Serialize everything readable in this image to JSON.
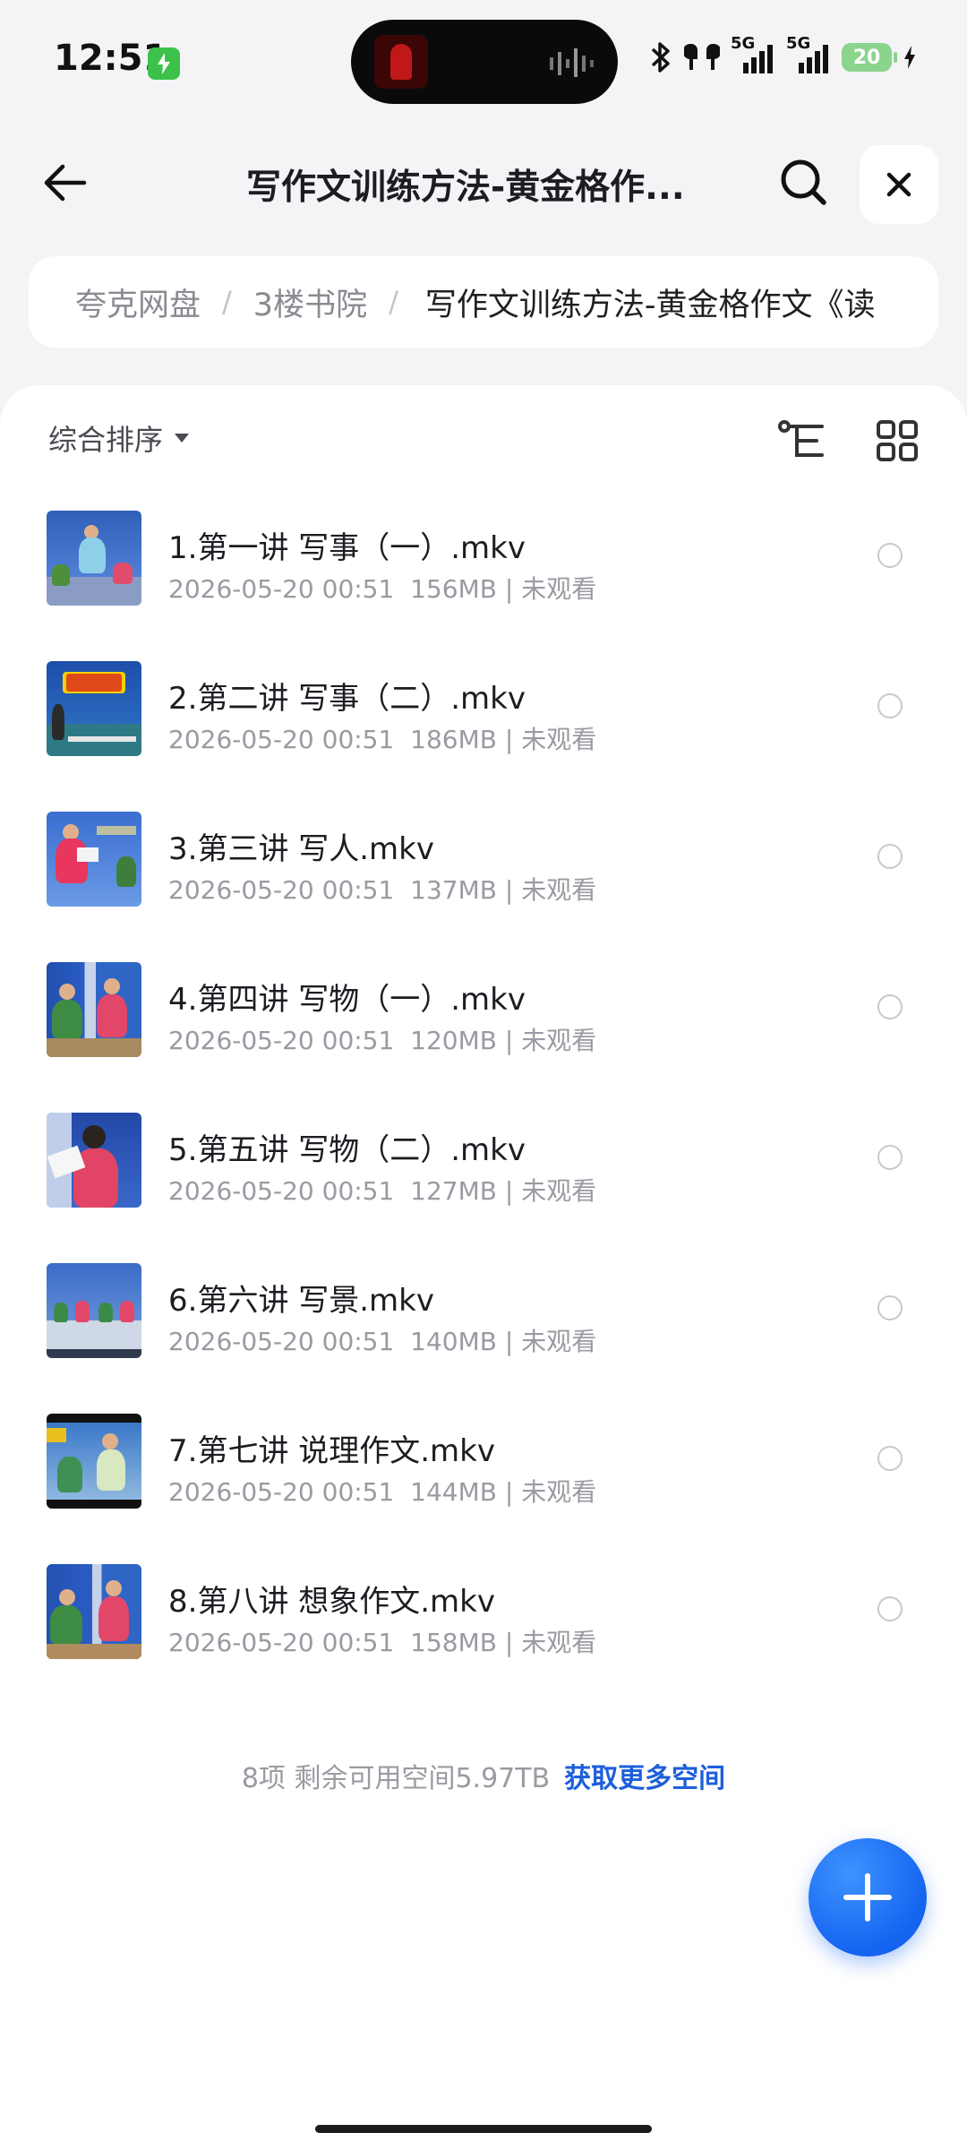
{
  "status_bar": {
    "time": "12:51",
    "network_1": "5G",
    "network_2": "5G",
    "battery": "20"
  },
  "nav": {
    "title": "写作文训练方法-黄金格作..."
  },
  "breadcrumb": {
    "items": [
      "夸克网盘",
      "3楼书院"
    ],
    "separator": "/",
    "current": "写作文训练方法-黄金格作文《读"
  },
  "toolbar": {
    "sort_label": "综合排序"
  },
  "files": [
    {
      "name": "1.第一讲 写事（一）.mkv",
      "date": "2026-05-20 00:51",
      "size": "156MB",
      "status": "未观看"
    },
    {
      "name": "2.第二讲 写事（二）.mkv",
      "date": "2026-05-20 00:51",
      "size": "186MB",
      "status": "未观看"
    },
    {
      "name": "3.第三讲 写人.mkv",
      "date": "2026-05-20 00:51",
      "size": "137MB",
      "status": "未观看"
    },
    {
      "name": "4.第四讲 写物（一）.mkv",
      "date": "2026-05-20 00:51",
      "size": "120MB",
      "status": "未观看"
    },
    {
      "name": "5.第五讲 写物（二）.mkv",
      "date": "2026-05-20 00:51",
      "size": "127MB",
      "status": "未观看"
    },
    {
      "name": "6.第六讲 写景.mkv",
      "date": "2026-05-20 00:51",
      "size": "140MB",
      "status": "未观看"
    },
    {
      "name": "7.第七讲 说理作文.mkv",
      "date": "2026-05-20 00:51",
      "size": "144MB",
      "status": "未观看"
    },
    {
      "name": "8.第八讲 想象作文.mkv",
      "date": "2026-05-20 00:51",
      "size": "158MB",
      "status": "未观看"
    }
  ],
  "footer": {
    "summary": "8项 剩余可用空间5.97TB",
    "link": "获取更多空间"
  },
  "colors": {
    "accent": "#1d5fdb",
    "fab": "#1464f0"
  }
}
